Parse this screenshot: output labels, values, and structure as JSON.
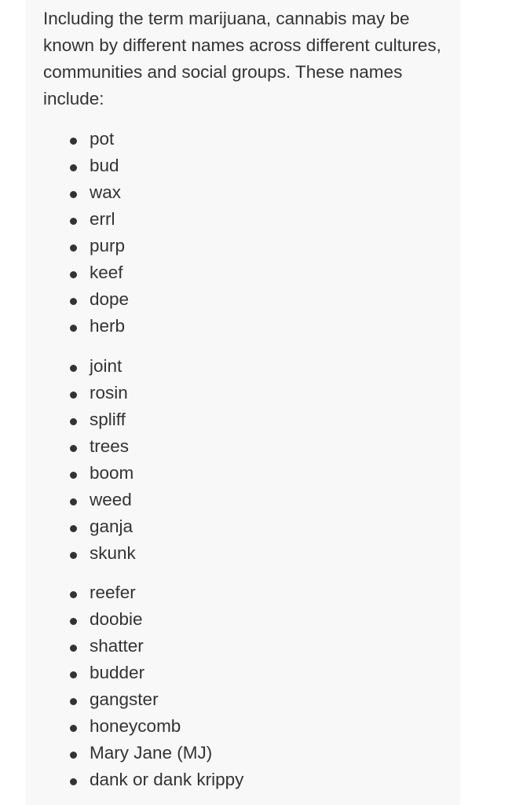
{
  "intro": "Including the term marijuana, cannabis may be known by different names across different cultures, communities and social groups. These names include:",
  "lists": [
    [
      "pot",
      "bud",
      "wax",
      "errl",
      "purp",
      "keef",
      "dope",
      "herb"
    ],
    [
      "joint",
      "rosin",
      "spliff",
      "trees",
      "boom",
      "weed",
      "ganja",
      "skunk"
    ],
    [
      "reefer",
      "doobie",
      "shatter",
      "budder",
      "gangster",
      "honeycomb",
      "Mary Jane (MJ)",
      "dank or dank krippy"
    ]
  ]
}
